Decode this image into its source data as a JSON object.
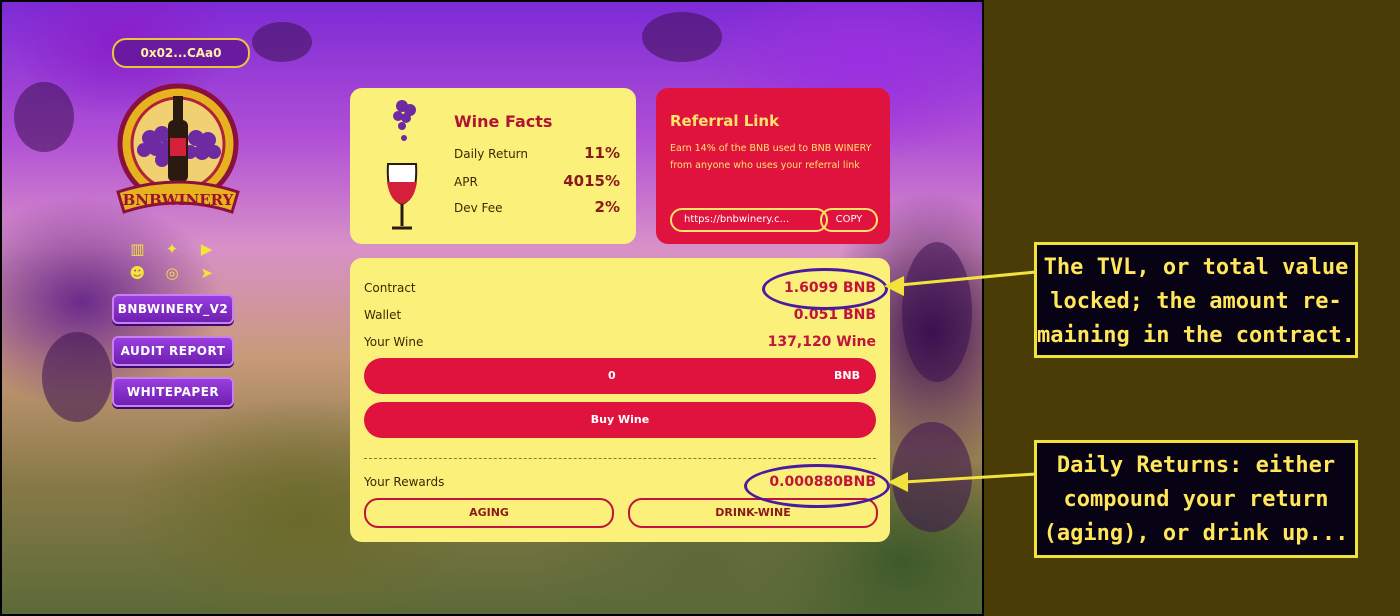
{
  "wallet": {
    "address": "0x02...CAa0"
  },
  "brand": {
    "name": "BNBWINERY"
  },
  "socials": [
    "chart-icon",
    "twitter-icon",
    "youtube-icon",
    "reddit-icon",
    "instagram-icon",
    "telegram-icon"
  ],
  "left_buttons": {
    "v2": "BNBWINERY_V2",
    "audit": "AUDIT REPORT",
    "whitepaper": "WHITEPAPER"
  },
  "facts": {
    "title": "Wine Facts",
    "daily_return_label": "Daily Return",
    "daily_return": "11%",
    "apr_label": "APR",
    "apr": "4015%",
    "dev_fee_label": "Dev Fee",
    "dev_fee": "2%"
  },
  "referral": {
    "title": "Referral Link",
    "description": "Earn 14% of the BNB used to BNB WINERY from anyone who uses your referral link",
    "link": "https://bnbwinery.c...",
    "copy_label": "COPY"
  },
  "stats": {
    "contract_label": "Contract",
    "contract": "1.6099 BNB",
    "wallet_label": "Wallet",
    "wallet": "0.051 BNB",
    "wine_label": "Your Wine",
    "wine": "137,120 Wine"
  },
  "buy": {
    "amount": "0",
    "unit": "BNB",
    "button": "Buy Wine"
  },
  "rewards": {
    "label": "Your Rewards",
    "value": "0.000880BNB",
    "aging": "AGING",
    "drink": "DRINK-WINE"
  },
  "annotations": {
    "tvl": [
      "The TVL, or total value",
      "locked; the amount re-",
      "maining in the contract."
    ],
    "daily": [
      "Daily Returns: either",
      "compound your return",
      "(aging), or drink up..."
    ]
  },
  "colors": {
    "accent": "#e0133f",
    "card": "#fbf17a",
    "purple": "#6e1fb0",
    "note_text": "#ffe65a"
  }
}
